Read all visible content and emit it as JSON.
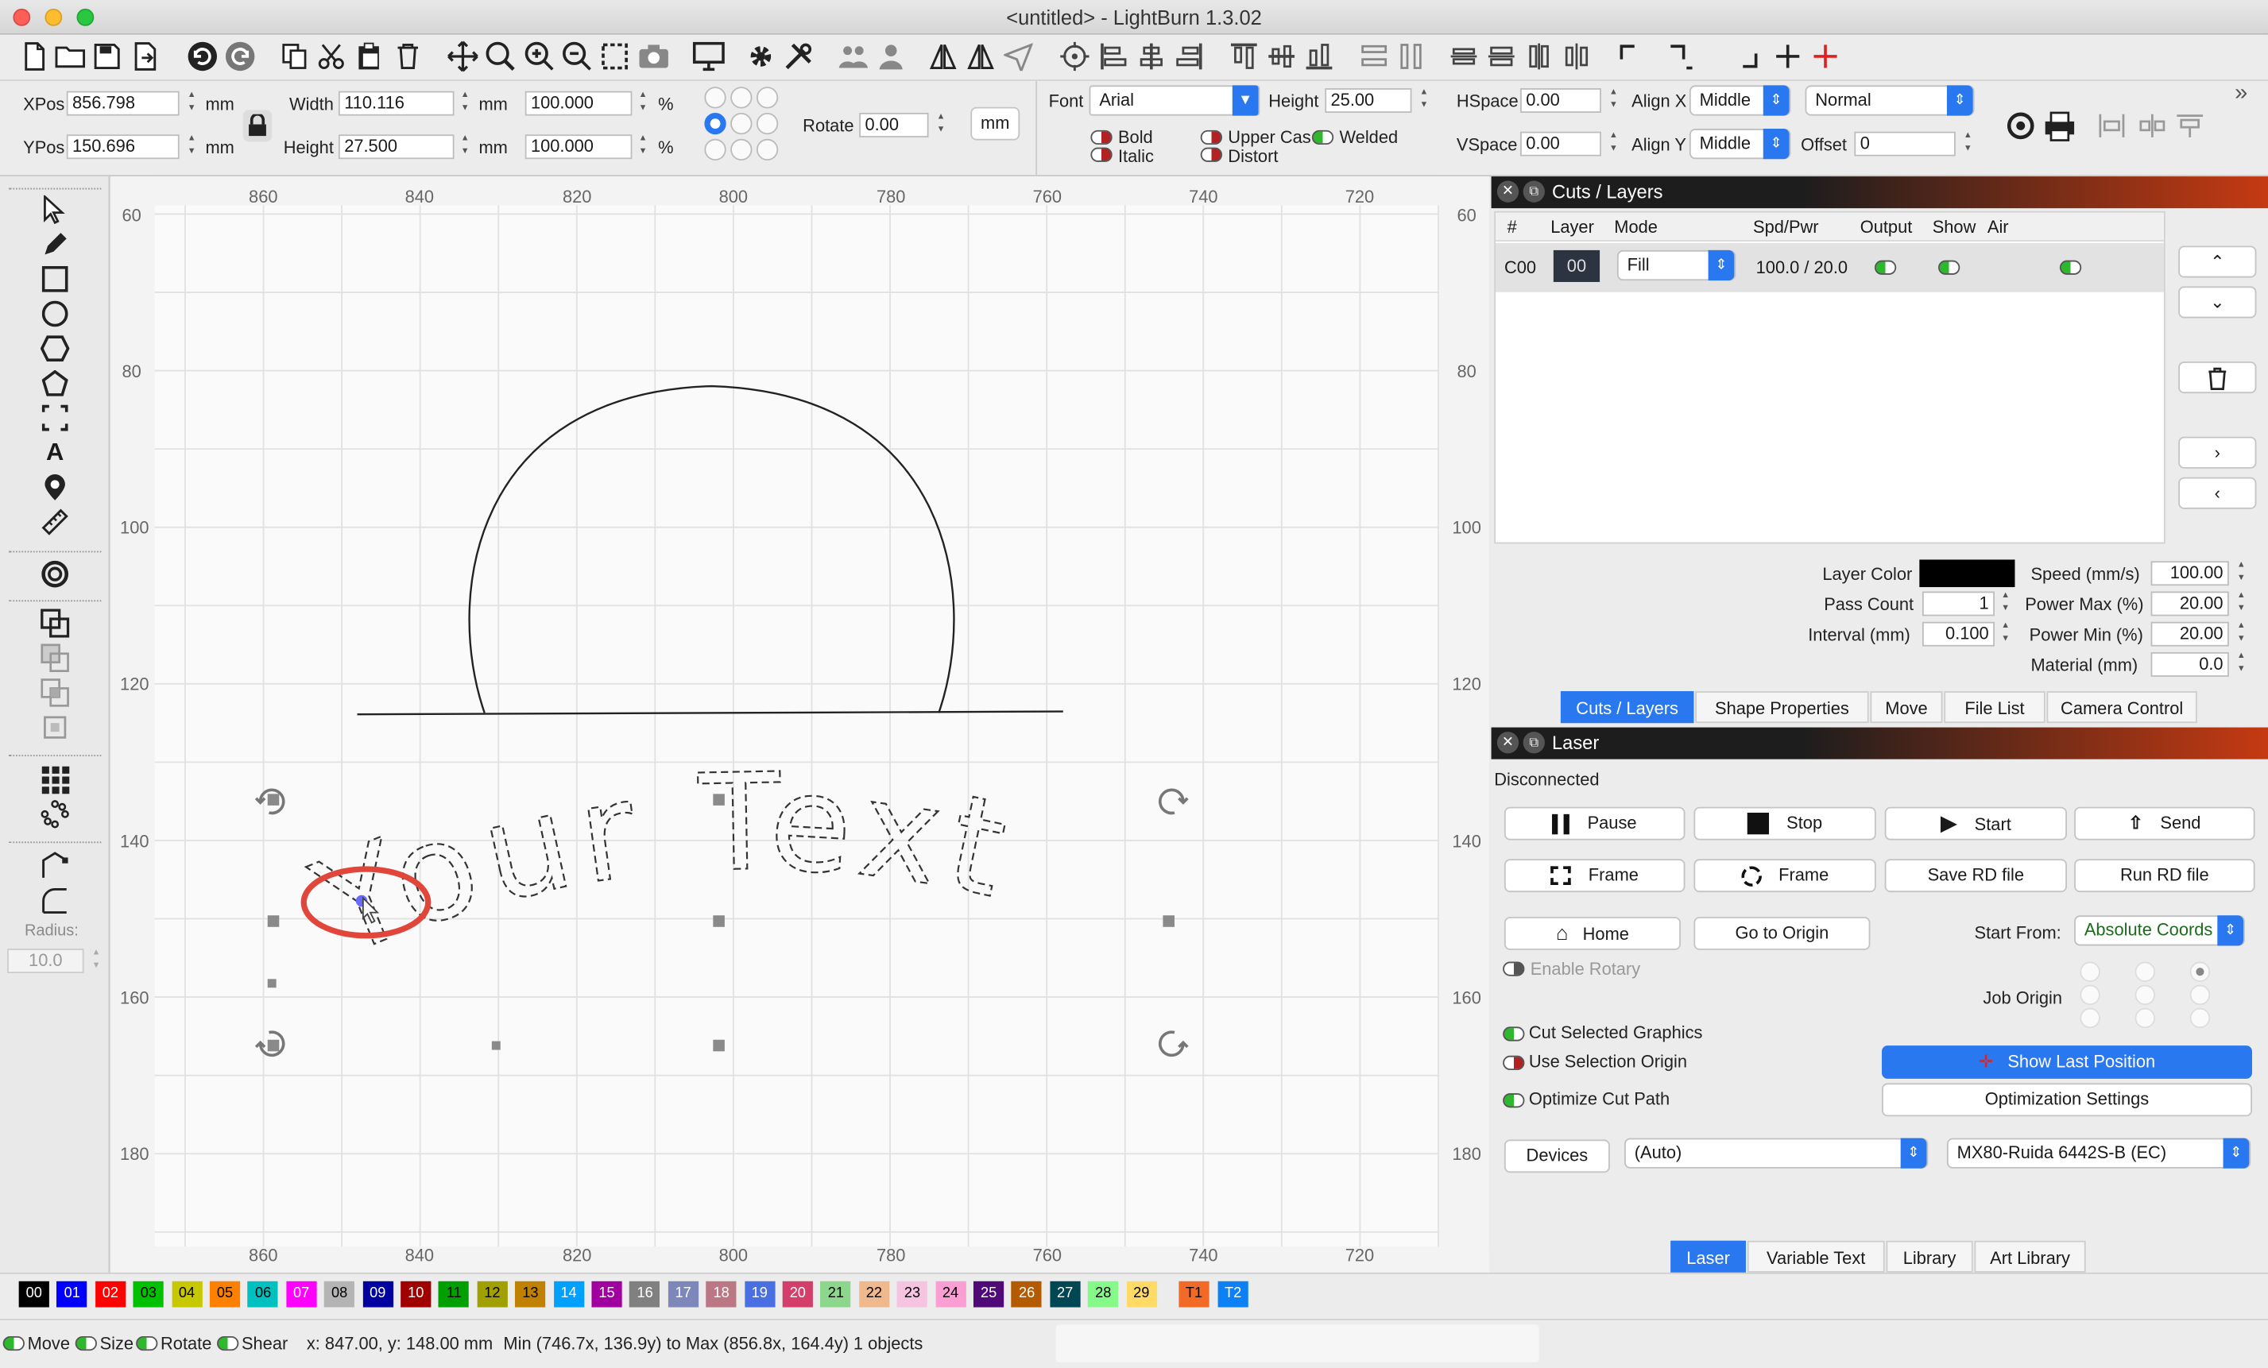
{
  "window": {
    "title": "<untitled> - LightBurn 1.3.02"
  },
  "numeric": {
    "xpos_label": "XPos",
    "xpos": "856.798",
    "ypos_label": "YPos",
    "ypos": "150.696",
    "unit": "mm",
    "width_label": "Width",
    "width": "110.116",
    "height_label": "Height",
    "height": "27.500",
    "scale_w": "100.000",
    "scale_h": "100.000",
    "pct": "%",
    "rotate_label": "Rotate",
    "rotate": "0.00",
    "mm_btn": "mm"
  },
  "text_opts": {
    "font_label": "Font",
    "font": "Arial",
    "height_label": "Height",
    "height": "25.00",
    "bold": "Bold",
    "italic": "Italic",
    "upper": "Upper Cas",
    "welded": "Welded",
    "distort": "Distort",
    "hspace_label": "HSpace",
    "hspace": "0.00",
    "vspace_label": "VSpace",
    "vspace": "0.00",
    "alignx_label": "Align X",
    "alignx": "Middle",
    "aligny_label": "Align Y",
    "aligny": "Middle",
    "mode": "Normal",
    "offset_label": "Offset",
    "offset": "0"
  },
  "tools": {
    "radius_label": "Radius:",
    "radius": "10.0"
  },
  "rulers": {
    "x": [
      "860",
      "840",
      "820",
      "800",
      "780",
      "760",
      "740",
      "720"
    ],
    "y": [
      "60",
      "80",
      "100",
      "120",
      "140",
      "160",
      "180"
    ]
  },
  "canvas": {
    "sample_text": "Your Text"
  },
  "cuts": {
    "title": "Cuts / Layers",
    "headers": [
      "#",
      "Layer",
      "Mode",
      "Spd/Pwr",
      "Output",
      "Show",
      "Air"
    ],
    "row": {
      "id": "C00",
      "layer": "00",
      "mode": "Fill",
      "spdpwr": "100.0 / 20.0"
    },
    "layer_color_label": "Layer Color",
    "layer_color": "#000000",
    "pass_count_label": "Pass Count",
    "pass_count": "1",
    "interval_label": "Interval (mm)",
    "interval": "0.100",
    "speed_label": "Speed (mm/s)",
    "speed": "100.00",
    "pmax_label": "Power Max (%)",
    "pmax": "20.00",
    "pmin_label": "Power Min (%)",
    "pmin": "20.00",
    "material_label": "Material (mm)",
    "material": "0.0",
    "tabs": [
      "Cuts / Layers",
      "Shape Properties",
      "Move",
      "File List",
      "Camera Control"
    ]
  },
  "laser": {
    "title": "Laser",
    "status": "Disconnected",
    "pause": "Pause",
    "stop": "Stop",
    "start": "Start",
    "send": "Send",
    "frame1": "Frame",
    "frame2": "Frame",
    "save_rd": "Save RD file",
    "run_rd": "Run RD file",
    "home": "Home",
    "goto_origin": "Go to Origin",
    "start_from_label": "Start From:",
    "start_from": "Absolute Coords",
    "enable_rotary": "Enable Rotary",
    "job_origin": "Job Origin",
    "cut_selected": "Cut Selected Graphics",
    "use_sel_origin": "Use Selection Origin",
    "optimize": "Optimize Cut Path",
    "show_last": "Show Last Position",
    "opt_settings": "Optimization Settings",
    "devices": "Devices",
    "port": "(Auto)",
    "device": "MX80-Ruida 6442S-B (EC)",
    "tabs": [
      "Laser",
      "Variable Text",
      "Library",
      "Art Library"
    ]
  },
  "palette": [
    {
      "l": "00",
      "c": "#000000",
      "t": "#ffffff"
    },
    {
      "l": "01",
      "c": "#0000ff",
      "t": "#ffffff"
    },
    {
      "l": "02",
      "c": "#ff0000",
      "t": "#ffffff"
    },
    {
      "l": "03",
      "c": "#00c000",
      "t": "#000000"
    },
    {
      "l": "04",
      "c": "#c8c800",
      "t": "#000000"
    },
    {
      "l": "05",
      "c": "#ff8000",
      "t": "#000000"
    },
    {
      "l": "06",
      "c": "#00c0c0",
      "t": "#000000"
    },
    {
      "l": "07",
      "c": "#ff00ff",
      "t": "#ffffff"
    },
    {
      "l": "08",
      "c": "#b4b4b4",
      "t": "#000000"
    },
    {
      "l": "09",
      "c": "#0000a0",
      "t": "#ffffff"
    },
    {
      "l": "10",
      "c": "#a00000",
      "t": "#ffffff"
    },
    {
      "l": "11",
      "c": "#00a000",
      "t": "#000000"
    },
    {
      "l": "12",
      "c": "#a0a000",
      "t": "#000000"
    },
    {
      "l": "13",
      "c": "#c08000",
      "t": "#000000"
    },
    {
      "l": "14",
      "c": "#00a0ff",
      "t": "#ffffff"
    },
    {
      "l": "15",
      "c": "#a000a0",
      "t": "#ffffff"
    },
    {
      "l": "16",
      "c": "#808080",
      "t": "#ffffff"
    },
    {
      "l": "17",
      "c": "#7d87b9",
      "t": "#ffffff"
    },
    {
      "l": "18",
      "c": "#bb7784",
      "t": "#ffffff"
    },
    {
      "l": "19",
      "c": "#4a6fe3",
      "t": "#ffffff"
    },
    {
      "l": "20",
      "c": "#d33f6a",
      "t": "#ffffff"
    },
    {
      "l": "21",
      "c": "#8cd78c",
      "t": "#000000"
    },
    {
      "l": "22",
      "c": "#f0b98d",
      "t": "#000000"
    },
    {
      "l": "23",
      "c": "#f6c4e1",
      "t": "#000000"
    },
    {
      "l": "24",
      "c": "#fa9ed4",
      "t": "#000000"
    },
    {
      "l": "25",
      "c": "#500a78",
      "t": "#ffffff"
    },
    {
      "l": "26",
      "c": "#b45a00",
      "t": "#ffffff"
    },
    {
      "l": "27",
      "c": "#004754",
      "t": "#ffffff"
    },
    {
      "l": "28",
      "c": "#86fa88",
      "t": "#000000"
    },
    {
      "l": "29",
      "c": "#ffdb66",
      "t": "#000000"
    },
    {
      "l": "T1",
      "c": "#f36926",
      "t": "#000000"
    },
    {
      "l": "T2",
      "c": "#0c81f6",
      "t": "#ffffff"
    }
  ],
  "statusbar": {
    "move": "Move",
    "size": "Size",
    "rotate": "Rotate",
    "shear": "Shear",
    "coords": "x: 847.00, y: 148.00 mm",
    "bounds": "Min (746.7x, 136.9y) to Max (856.8x, 164.4y)",
    "objects": "1 objects"
  }
}
